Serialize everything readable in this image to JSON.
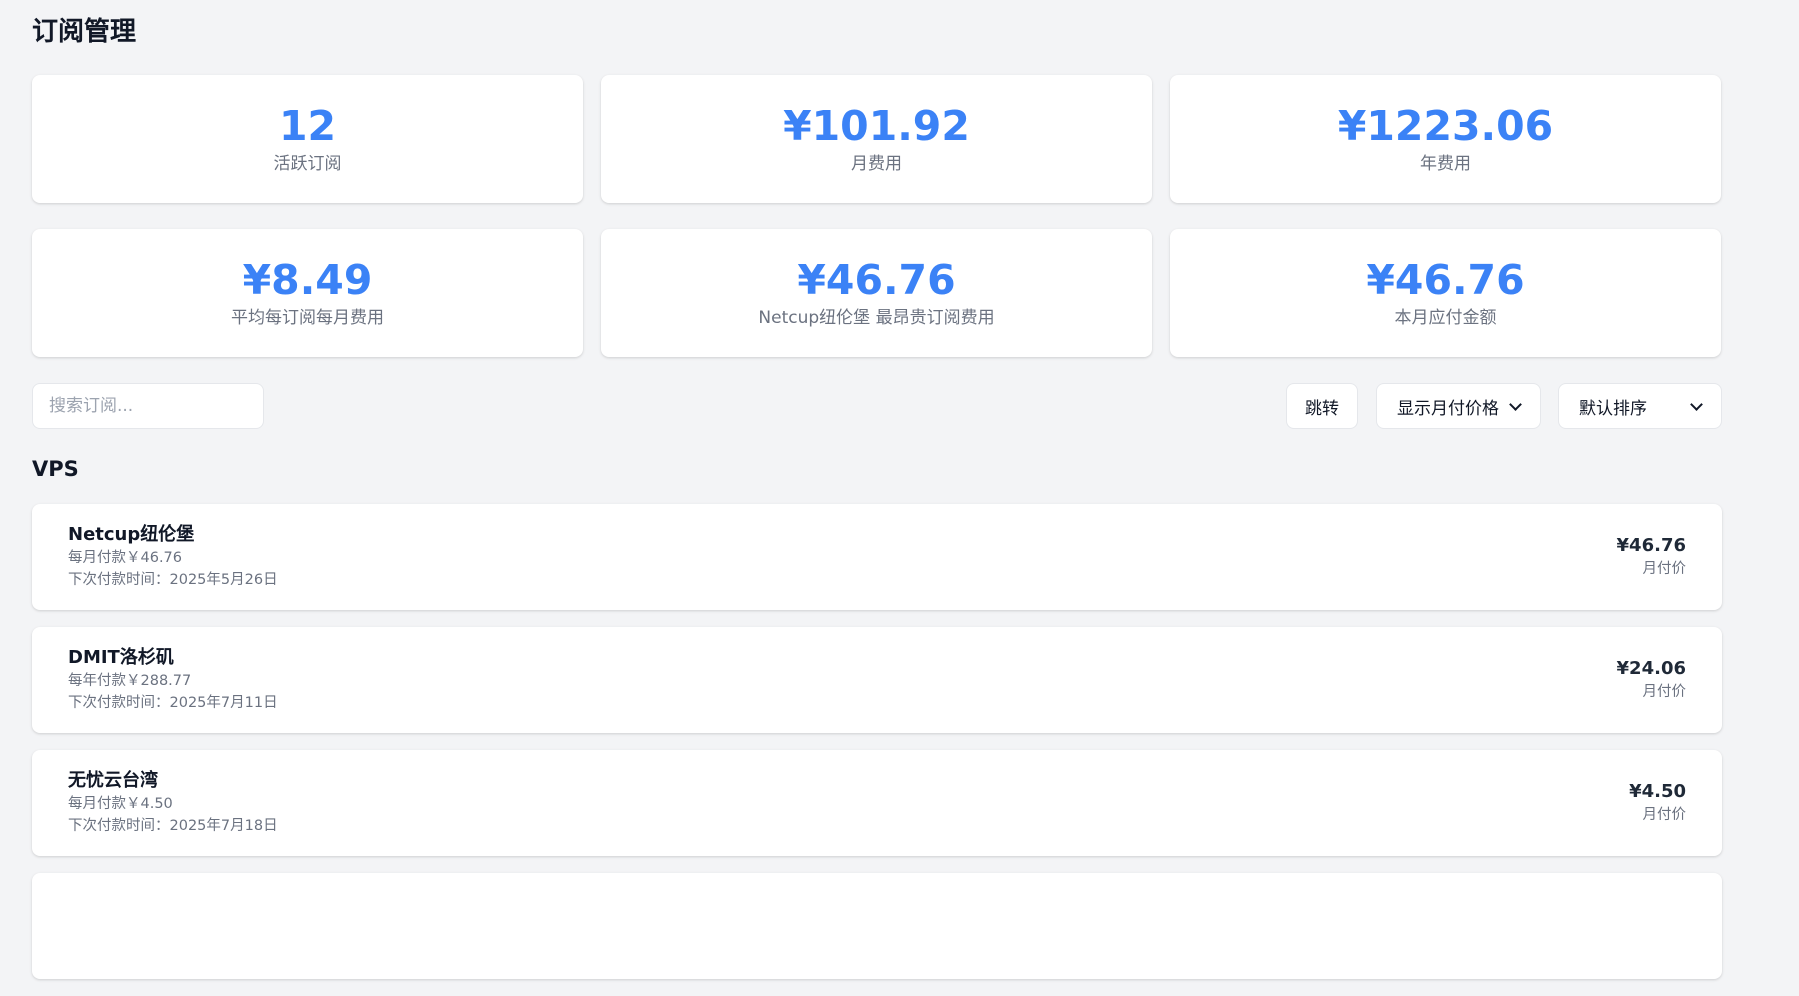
{
  "page": {
    "title": "订阅管理"
  },
  "stats": [
    {
      "value": "12",
      "label": "活跃订阅"
    },
    {
      "value": "¥101.92",
      "label": "月费用"
    },
    {
      "value": "¥1223.06",
      "label": "年费用"
    },
    {
      "value": "¥8.49",
      "label": "平均每订阅每月费用"
    },
    {
      "value": "¥46.76",
      "label": "Netcup纽伦堡 最昂贵订阅费用"
    },
    {
      "value": "¥46.76",
      "label": "本月应付金额"
    }
  ],
  "toolbar": {
    "search_placeholder": "搜索订阅...",
    "jump_label": "跳转",
    "price_select_value": "显示月付价格",
    "sort_select_value": "默认排序"
  },
  "group": {
    "title": "VPS",
    "items": [
      {
        "name": "Netcup纽伦堡",
        "payment": "每月付款￥46.76",
        "next_payment": "下次付款时间：2025年5月26日",
        "price": "¥46.76",
        "price_label": "月付价"
      },
      {
        "name": "DMIT洛杉矶",
        "payment": "每年付款￥288.77",
        "next_payment": "下次付款时间：2025年7月11日",
        "price": "¥24.06",
        "price_label": "月付价"
      },
      {
        "name": "无忧云台湾",
        "payment": "每月付款￥4.50",
        "next_payment": "下次付款时间：2025年7月18日",
        "price": "¥4.50",
        "price_label": "月付价"
      },
      {
        "name": "",
        "payment": "",
        "next_payment": "",
        "price": "",
        "price_label": ""
      }
    ]
  },
  "colors": {
    "accent": "#3b82f6",
    "background": "#f3f4f6",
    "card": "#ffffff",
    "muted_text": "#6b7280"
  }
}
